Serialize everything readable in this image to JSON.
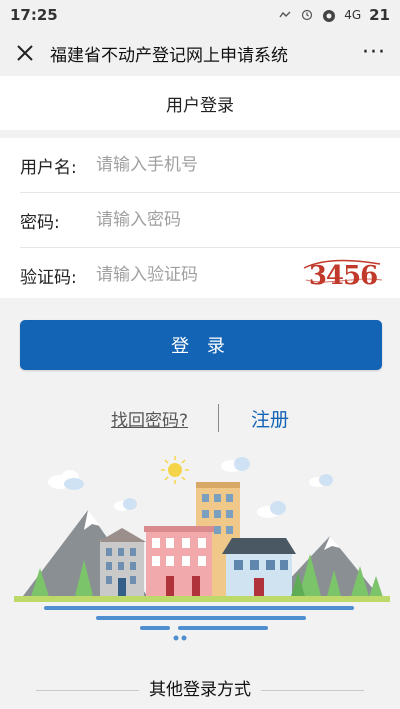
{
  "status_bar": {
    "time": "17:25",
    "network": "4G",
    "battery": "21"
  },
  "nav": {
    "title": "福建省不动产登记网上申请系统",
    "more": "···"
  },
  "page_header": "用户登录",
  "form": {
    "username_label": "用户名:",
    "username_placeholder": "请输入手机号",
    "password_label": "密码:",
    "password_placeholder": "请输入密码",
    "captcha_label": "验证码:",
    "captcha_placeholder": "请输入验证码",
    "captcha_text": "3456"
  },
  "login_button": "登 录",
  "links": {
    "forgot_password": "找回密码?",
    "register": "注册"
  },
  "other_login": "其他登录方式",
  "colors": {
    "primary": "#1364b5",
    "captcha": "#c0392b",
    "background": "#f2f2f2"
  }
}
